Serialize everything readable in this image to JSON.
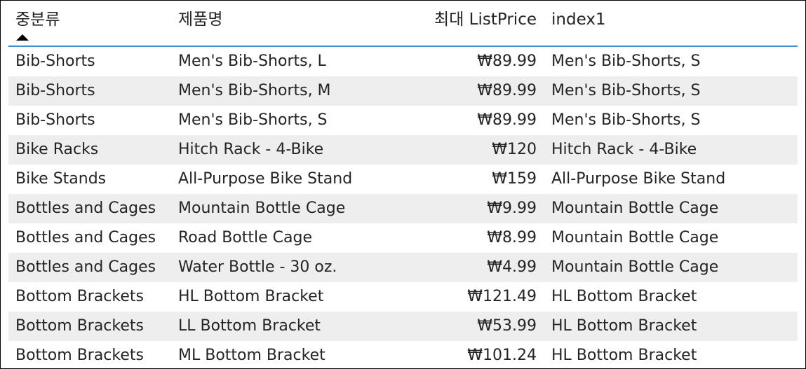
{
  "table": {
    "columns": [
      "중분류",
      "제품명",
      "최대 ListPrice",
      "index1"
    ],
    "sort_icon": "sort-ascending-icon",
    "rows": [
      [
        "Bib-Shorts",
        "Men's Bib-Shorts, L",
        "₩89.99",
        "Men's Bib-Shorts, S"
      ],
      [
        "Bib-Shorts",
        "Men's Bib-Shorts, M",
        "₩89.99",
        "Men's Bib-Shorts, S"
      ],
      [
        "Bib-Shorts",
        "Men's Bib-Shorts, S",
        "₩89.99",
        "Men's Bib-Shorts, S"
      ],
      [
        "Bike Racks",
        "Hitch Rack - 4-Bike",
        "₩120",
        "Hitch Rack - 4-Bike"
      ],
      [
        "Bike Stands",
        "All-Purpose Bike Stand",
        "₩159",
        "All-Purpose Bike Stand"
      ],
      [
        "Bottles and Cages",
        "Mountain Bottle Cage",
        "₩9.99",
        "Mountain Bottle Cage"
      ],
      [
        "Bottles and Cages",
        "Road Bottle Cage",
        "₩8.99",
        "Mountain Bottle Cage"
      ],
      [
        "Bottles and Cages",
        "Water Bottle - 30 oz.",
        "₩4.99",
        "Mountain Bottle Cage"
      ],
      [
        "Bottom Brackets",
        "HL Bottom Bracket",
        "₩121.49",
        "HL Bottom Bracket"
      ],
      [
        "Bottom Brackets",
        "LL Bottom Bracket",
        "₩53.99",
        "HL Bottom Bracket"
      ],
      [
        "Bottom Brackets",
        "ML Bottom Bracket",
        "₩101.24",
        "HL Bottom Bracket"
      ]
    ]
  },
  "colors": {
    "header_rule": "#3b8bd3",
    "alt_row": "#eeeeee",
    "text": "#252423"
  }
}
